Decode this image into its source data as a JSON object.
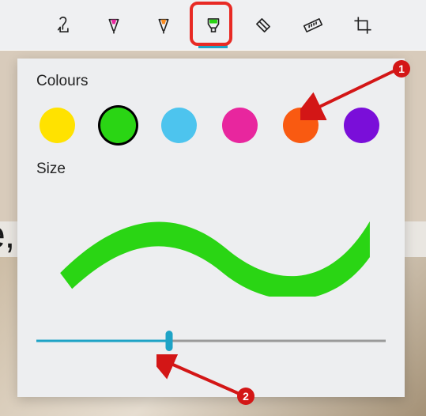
{
  "toolbar": {
    "tools": [
      {
        "name": "touch-writing-icon",
        "selected": false
      },
      {
        "name": "pen-icon",
        "selected": false
      },
      {
        "name": "pencil-icon",
        "selected": false
      },
      {
        "name": "highlighter-icon",
        "selected": true
      },
      {
        "name": "eraser-icon",
        "selected": false
      },
      {
        "name": "ruler-icon",
        "selected": false
      },
      {
        "name": "crop-icon",
        "selected": false
      }
    ]
  },
  "panel": {
    "colours_label": "Colours",
    "size_label": "Size",
    "colours": [
      {
        "hex": "#ffe200",
        "selected": false
      },
      {
        "hex": "#2ad514",
        "selected": true
      },
      {
        "hex": "#4dc4ee",
        "selected": false
      },
      {
        "hex": "#e8269e",
        "selected": false
      },
      {
        "hex": "#f95a11",
        "selected": false
      },
      {
        "hex": "#7a0ed9",
        "selected": false
      }
    ],
    "stroke_preview_colour": "#2ad514",
    "slider": {
      "percent": 38
    }
  },
  "annotations": [
    {
      "num": "1"
    },
    {
      "num": "2"
    }
  ],
  "bg_text_fragment": "e,"
}
